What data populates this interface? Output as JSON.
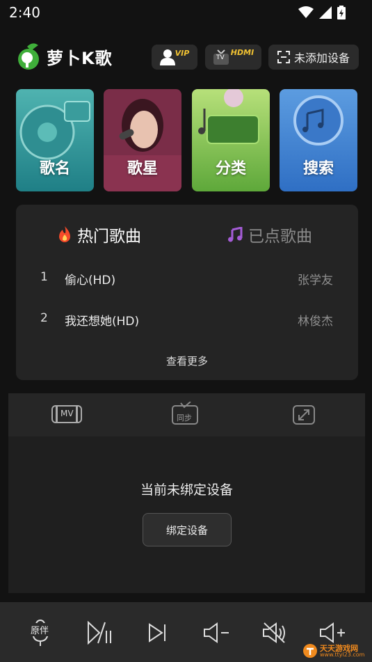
{
  "status": {
    "time": "2:40"
  },
  "header": {
    "logo_text": "萝卜K歌",
    "vip_tag": "VIP",
    "hdmi_tag": "HDMI",
    "tv_tag": "TV",
    "device_label": "未添加设备"
  },
  "tiles": [
    {
      "label": "歌名",
      "color": "#2a8f8f"
    },
    {
      "label": "歌星",
      "color": "#8a3350"
    },
    {
      "label": "分类",
      "color": "#6bb043"
    },
    {
      "label": "搜索",
      "color": "#3f7fd0"
    }
  ],
  "songs_card": {
    "tab_hot": "热门歌曲",
    "tab_queued": "已点歌曲",
    "songs": [
      {
        "num": "1",
        "title": "偷心(HD)",
        "artist": "张学友"
      },
      {
        "num": "2",
        "title": "我还想她(HD)",
        "artist": "林俊杰"
      }
    ],
    "more": "查看更多"
  },
  "modes": {
    "mv": "MV",
    "sync": "同步"
  },
  "device_panel": {
    "message": "当前未绑定设备",
    "bind_button": "绑定设备"
  },
  "controls": {
    "original_accompany": "原伴"
  },
  "watermark": {
    "site": "天天游戏网",
    "url": "www.ttyl23.com"
  }
}
